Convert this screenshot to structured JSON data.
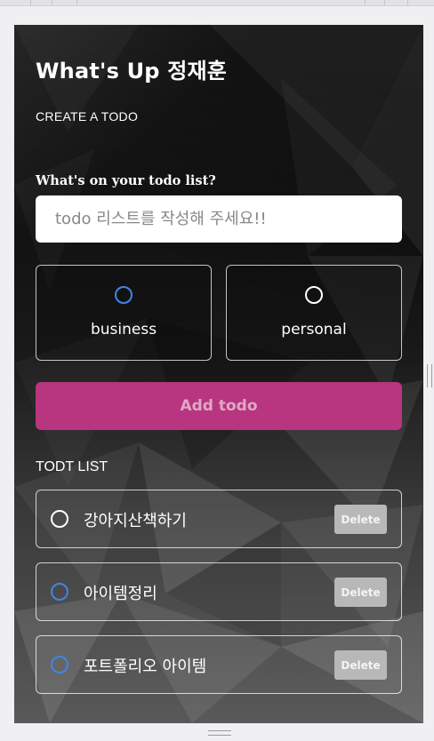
{
  "app": {
    "title": "What's Up 정재훈"
  },
  "create": {
    "heading": "CREATE A TODO"
  },
  "form": {
    "question": "What's on your todo list?",
    "input_placeholder": "todo 리스트를 작성해 주세요!!",
    "input_value": ""
  },
  "categories": [
    {
      "label": "business",
      "accent_color": "#3f86e6"
    },
    {
      "label": "personal",
      "accent_color": "#ffffff"
    }
  ],
  "add_button": {
    "label": "Add todo",
    "color": "#b8357f"
  },
  "todo_list": {
    "heading": "TODT LIST",
    "items": [
      {
        "text": "강아지산책하기",
        "check_color": "#ffffff",
        "delete_label": "Delete"
      },
      {
        "text": "아이템정리",
        "check_color": "#3f86e6",
        "delete_label": "Delete"
      },
      {
        "text": "포트폴리오 아이템",
        "check_color": "#3f86e6",
        "delete_label": "Delete"
      }
    ]
  }
}
